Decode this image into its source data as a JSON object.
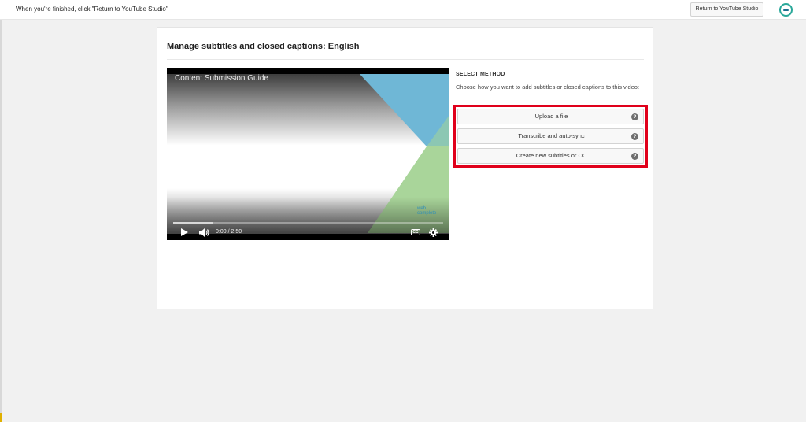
{
  "topbar": {
    "message": "When you're finished, click \"Return to YouTube Studio\"",
    "return_button": "Return to YouTube Studio",
    "logo_icon": "circle-logo-icon"
  },
  "card": {
    "title": "Manage subtitles and closed captions: English"
  },
  "video": {
    "title": "Content Submission Guide",
    "brand": "web complete",
    "time_current": "0:00",
    "time_separator": "/",
    "time_total": "2:50",
    "progress_loaded_percent": 15,
    "cc_label": "CC",
    "icons": [
      "play-icon",
      "volume-icon",
      "cc-icon",
      "gear-icon"
    ]
  },
  "method": {
    "label": "SELECT METHOD",
    "description": "Choose how you want to add subtitles or closed captions to this video:",
    "options": [
      {
        "label": "Upload a file",
        "help": "?"
      },
      {
        "label": "Transcribe and auto-sync",
        "help": "?"
      },
      {
        "label": "Create new subtitles or CC",
        "help": "?"
      }
    ],
    "highlight_color": "#e0001b"
  },
  "colors": {
    "page_background": "#f1f1f1",
    "card_background": "#ffffff",
    "video_blue": "#6fb7d6",
    "video_green": "#a9d59a"
  }
}
